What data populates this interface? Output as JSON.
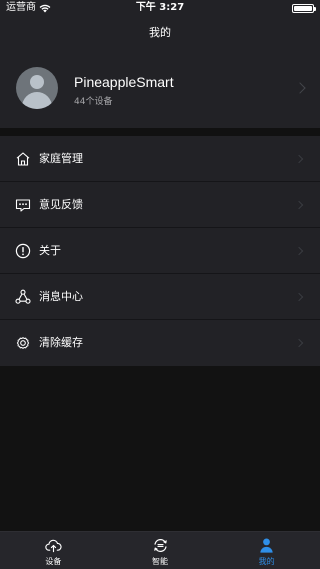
{
  "status_bar": {
    "carrier": "运营商",
    "time": "下午 3:27",
    "battery_level": 1.0
  },
  "nav": {
    "title": "我的"
  },
  "profile": {
    "name": "PineappleSmart",
    "device_count": "44个设备",
    "avatar_icon": "user-avatar-placeholder"
  },
  "menu": {
    "items": [
      {
        "label": "家庭管理",
        "icon": "home-icon"
      },
      {
        "label": "意见反馈",
        "icon": "feedback-icon"
      },
      {
        "label": "关于",
        "icon": "info-icon"
      },
      {
        "label": "消息中心",
        "icon": "message-hub-icon"
      },
      {
        "label": "清除缓存",
        "icon": "settings-gear-icon"
      }
    ]
  },
  "tabbar": {
    "tabs": [
      {
        "label": "设备",
        "icon": "cloud-upload-icon",
        "active": false
      },
      {
        "label": "智能",
        "icon": "smart-sync-icon",
        "active": false
      },
      {
        "label": "我的",
        "icon": "person-icon",
        "active": true
      }
    ]
  },
  "colors": {
    "background": "#121212",
    "panel": "#222226",
    "accent": "#2f8fe8",
    "secondary_text": "#a5a5a8"
  }
}
